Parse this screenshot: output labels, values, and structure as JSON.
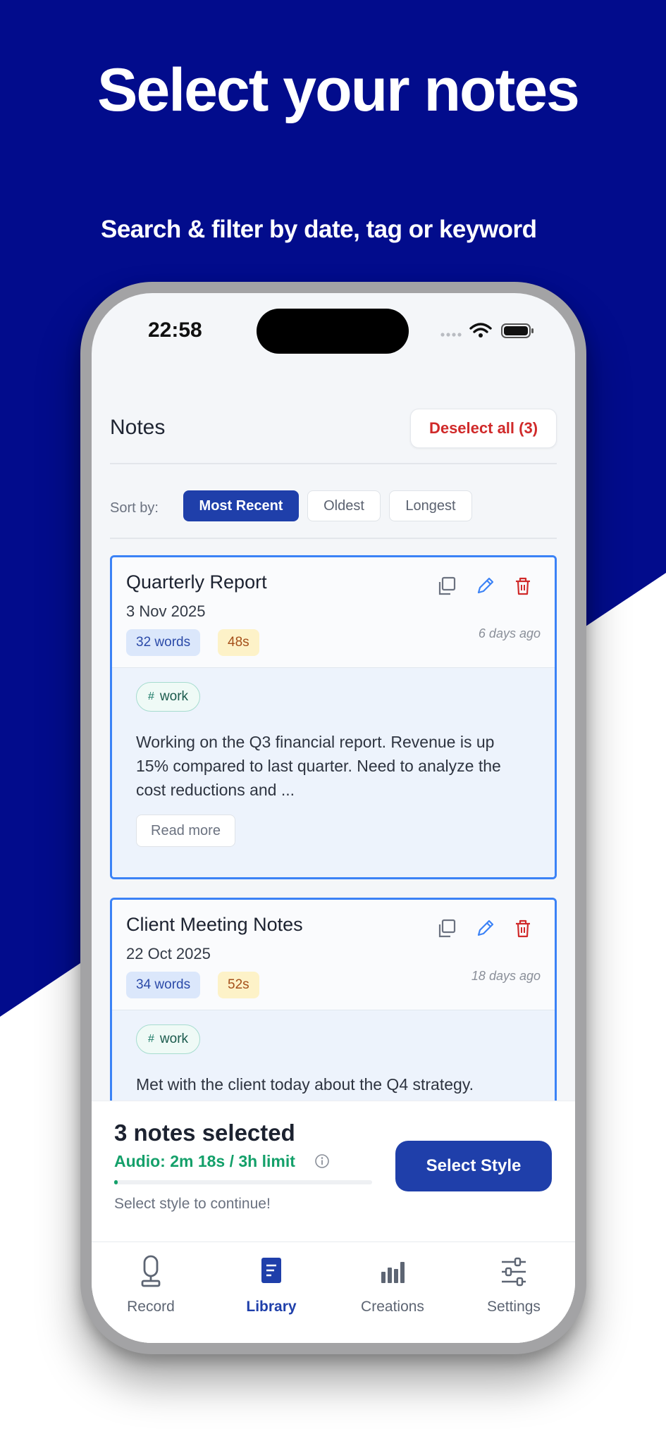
{
  "hero": {
    "title": "Select your notes",
    "subtitle": "Search & filter by date, tag or keyword"
  },
  "status_bar": {
    "time": "22:58"
  },
  "header": {
    "title": "Notes",
    "deselect_label": "Deselect all (3)"
  },
  "sort": {
    "label": "Sort by:",
    "options": [
      "Most Recent",
      "Oldest",
      "Longest"
    ],
    "selected": "Most Recent"
  },
  "notes": [
    {
      "title": "Quarterly Report",
      "date": "3 Nov 2025",
      "words": "32 words",
      "duration": "48s",
      "ago": "6 days ago",
      "tag": "work",
      "excerpt": "Working on the Q3 financial report. Revenue is up 15% compared to last quarter. Need to analyze the cost reductions and ...",
      "read_more": "Read more",
      "selected": true
    },
    {
      "title": "Client Meeting Notes",
      "date": "22 Oct 2025",
      "words": "34 words",
      "duration": "52s",
      "ago": "18 days ago",
      "tag": "work",
      "excerpt": "Met with the client today about the Q4 strategy.",
      "selected": true
    }
  ],
  "selection": {
    "count_text": "3 notes selected",
    "audio_text": "Audio: 2m 18s / 3h limit",
    "audio_progress_fraction": 0.013,
    "hint": "Select style to continue!",
    "cta": "Select Style"
  },
  "tabs": [
    {
      "label": "Record",
      "icon": "microphone-icon",
      "active": false
    },
    {
      "label": "Library",
      "icon": "document-icon",
      "active": true
    },
    {
      "label": "Creations",
      "icon": "bar-chart-icon",
      "active": false
    },
    {
      "label": "Settings",
      "icon": "sliders-icon",
      "active": false
    }
  ],
  "colors": {
    "hero_background": "#020c8c",
    "accent": "#1f3faa",
    "danger": "#d02a2a",
    "success": "#14a06a",
    "card_border": "#3b82f6"
  }
}
